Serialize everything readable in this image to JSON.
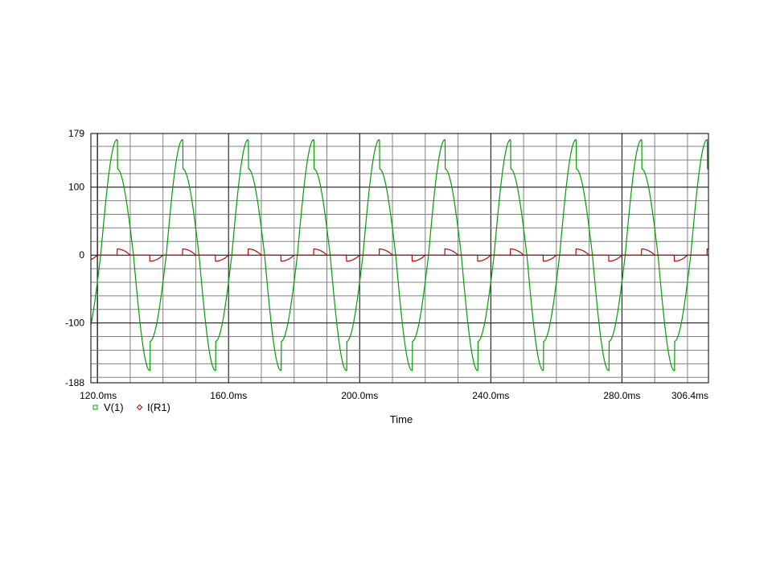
{
  "chart_data": {
    "type": "line",
    "title": "",
    "xlabel": "Time",
    "ylabel": "",
    "xlim": [
      118.0,
      306.4
    ],
    "ylim": [
      -188,
      179
    ],
    "x_unit": "ms",
    "x_ticks": [
      {
        "value": 120.0,
        "label": "120.0ms"
      },
      {
        "value": 160.0,
        "label": "160.0ms"
      },
      {
        "value": 200.0,
        "label": "200.0ms"
      },
      {
        "value": 240.0,
        "label": "240.0ms"
      },
      {
        "value": 280.0,
        "label": "280.0ms"
      },
      {
        "value": 306.4,
        "label": "306.4ms"
      }
    ],
    "y_ticks": [
      {
        "value": 179,
        "label": "179"
      },
      {
        "value": 100,
        "label": "100"
      },
      {
        "value": 0,
        "label": "0"
      },
      {
        "value": -100,
        "label": "-100"
      },
      {
        "value": -188,
        "label": "-188"
      }
    ],
    "grid": true,
    "legend_position": "bottom-left",
    "period_ms": 20,
    "series": [
      {
        "name": "V(1)",
        "color": "#00a000",
        "marker": "square",
        "peak": 168,
        "knee": 127,
        "trough": -170,
        "knee_neg": -127,
        "description_points": [
          [
            118.0,
            -72
          ],
          [
            120.0,
            -40
          ],
          [
            121.0,
            0
          ],
          [
            122.0,
            55
          ],
          [
            123.0,
            105
          ],
          [
            124.0,
            145
          ],
          [
            125.0,
            163
          ],
          [
            125.7,
            168
          ],
          [
            126.0,
            127
          ],
          [
            127.0,
            125
          ],
          [
            128.0,
            108
          ],
          [
            129.0,
            75
          ],
          [
            130.0,
            38
          ],
          [
            131.0,
            0
          ],
          [
            132.0,
            -55
          ],
          [
            133.0,
            -105
          ],
          [
            134.0,
            -145
          ],
          [
            135.0,
            -163
          ],
          [
            135.7,
            -170
          ],
          [
            136.0,
            -127
          ],
          [
            137.0,
            -125
          ],
          [
            138.0,
            -108
          ],
          [
            139.0,
            -75
          ],
          [
            140.0,
            -38
          ],
          [
            141.0,
            0
          ]
        ]
      },
      {
        "name": "I(R1)",
        "color": "#c00000",
        "marker": "diamond",
        "peak": 9,
        "trough": -9
      }
    ]
  }
}
